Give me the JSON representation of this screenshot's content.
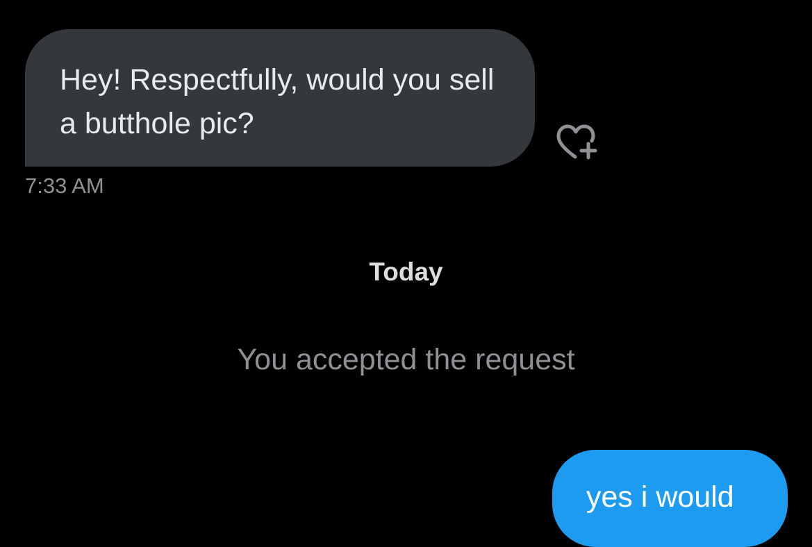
{
  "conversation": {
    "incoming_message": {
      "text": "Hey! Respectfully, would you sell a butthole pic?",
      "timestamp": "7:33 AM",
      "reaction_icon": "heart-plus-icon"
    },
    "day_separator": "Today",
    "system_message": "You accepted the request",
    "outgoing_message": {
      "text": "yes i would"
    }
  },
  "colors": {
    "background": "#000000",
    "incoming_bubble": "#34373b",
    "outgoing_bubble": "#1d9bf0",
    "secondary_text": "#8e9196"
  }
}
